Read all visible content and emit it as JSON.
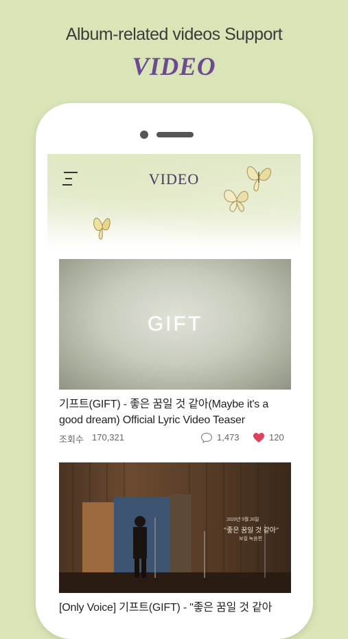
{
  "promo": {
    "line1": "Album-related videos Support",
    "line2": "VIDEO"
  },
  "header": {
    "title": "VIDEO"
  },
  "videos": [
    {
      "thumbnail_text": "GIFT",
      "title": "기프트(GIFT) - 좋은 꿈일 것 같아(Maybe it's a good dream) Official Lyric Video Teaser",
      "views_label": "조회수",
      "views": "170,321",
      "comments": "1,473",
      "likes": "120"
    },
    {
      "overlay_date": "2020년 9월 26일",
      "overlay_title": "\"좋은 꿈일 것 같아\"",
      "overlay_sub": "보컬 녹음편",
      "title": "[Only Voice] 기프트(GIFT) - \"좋은 꿈일 것 같아"
    }
  ],
  "colors": {
    "background": "#d9e5b6",
    "accent_purple": "#6b4a91",
    "heart": "#e0405a"
  },
  "icons": [
    "menu-icon",
    "butterfly-icon",
    "comment-icon",
    "heart-icon"
  ]
}
